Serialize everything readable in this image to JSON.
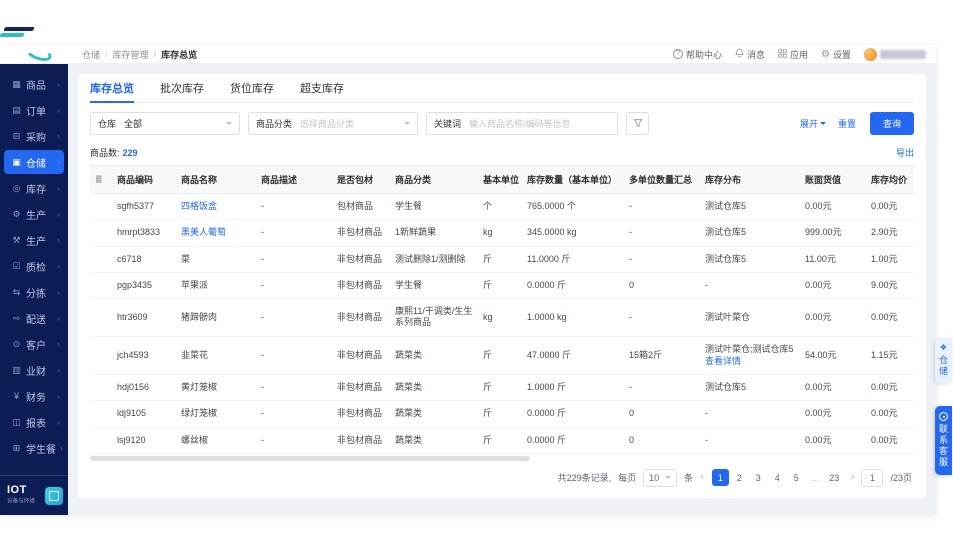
{
  "breadcrumb": {
    "items": [
      "仓储",
      "库存管理",
      "库存总览"
    ]
  },
  "topbar": {
    "help": "帮助中心",
    "messages": "消息",
    "apps": "应用",
    "settings": "设置"
  },
  "icons": {
    "help": "?",
    "gear": "⚙",
    "prev": "‹",
    "next": "›",
    "column_settings": "≣",
    "sidebar_chevron": "›",
    "warehouse_tag": "❖"
  },
  "sidebar": {
    "items": [
      {
        "id": "goods",
        "label": "商品",
        "glyph": "▦"
      },
      {
        "id": "orders",
        "label": "订单",
        "glyph": "▤"
      },
      {
        "id": "purchase",
        "label": "采购",
        "glyph": "⊟"
      },
      {
        "id": "warehouse",
        "label": "仓储",
        "glyph": "▣",
        "active": true
      },
      {
        "id": "inventory",
        "label": "库存",
        "glyph": "◎"
      },
      {
        "id": "production-1",
        "label": "生产",
        "glyph": "⚙"
      },
      {
        "id": "production-2",
        "label": "生产",
        "glyph": "⚒"
      },
      {
        "id": "quality",
        "label": "质检",
        "glyph": "☑"
      },
      {
        "id": "sorting",
        "label": "分拣",
        "glyph": "⇆"
      },
      {
        "id": "delivery",
        "label": "配送",
        "glyph": "⇨"
      },
      {
        "id": "customers",
        "label": "客户",
        "glyph": "⊙"
      },
      {
        "id": "biz-finance",
        "label": "业财",
        "glyph": "▥"
      },
      {
        "id": "finance",
        "label": "财务",
        "glyph": "¥"
      },
      {
        "id": "reports",
        "label": "报表",
        "glyph": "◫"
      },
      {
        "id": "student-meal",
        "label": "学生餐",
        "glyph": "⊞"
      }
    ],
    "iot": {
      "title": "IOT",
      "subtitle": "设备与环境"
    }
  },
  "tabs": [
    {
      "id": "overview",
      "label": "库存总览",
      "active": true
    },
    {
      "id": "batch",
      "label": "批次库存"
    },
    {
      "id": "location",
      "label": "货位库存"
    },
    {
      "id": "overdraft",
      "label": "超支库存"
    }
  ],
  "filters": {
    "warehouse": {
      "label": "仓库",
      "value": "全部"
    },
    "category": {
      "label": "商品分类",
      "placeholder": "选择商品分类"
    },
    "keyword": {
      "label": "关键词",
      "placeholder": "输入商品名称/编码等信息"
    },
    "expand": "展开",
    "reset": "重置",
    "search": "查询"
  },
  "summary": {
    "label": "商品数:",
    "count": "229",
    "export": "导出"
  },
  "table": {
    "headers": [
      "商品编码",
      "商品名称",
      "商品描述",
      "是否包材",
      "商品分类",
      "基本单位",
      "库存数量（基本单位）",
      "多单位数量汇总",
      "库存分布",
      "账面货值",
      "库存均价"
    ],
    "rows": [
      {
        "code": "sgfh5377",
        "name": "四格饭盒",
        "name_link": true,
        "desc": "-",
        "packing": "包材商品",
        "category": "学生餐",
        "unit": "个",
        "qty": "765.0000 个",
        "multi": "-",
        "dist": "测试仓库5",
        "dist_detail": "",
        "value": "0.00元",
        "price": "0.00元"
      },
      {
        "code": "hmrpt3833",
        "name": "黑美人葡萄",
        "name_link": true,
        "desc": "-",
        "packing": "非包材商品",
        "category": "1新鲜蔬果",
        "unit": "kg",
        "qty": "345.0000 kg",
        "multi": "-",
        "dist": "测试仓库5",
        "dist_detail": "",
        "value": "999.00元",
        "price": "2.90元"
      },
      {
        "code": "c6718",
        "name": "菜",
        "name_link": false,
        "desc": "-",
        "packing": "非包材商品",
        "category": "测试删除1/测删除",
        "unit": "斤",
        "qty": "11.0000 斤",
        "multi": "-",
        "dist": "测试仓库5",
        "dist_detail": "",
        "value": "11.00元",
        "price": "1.00元"
      },
      {
        "code": "pgp3435",
        "name": "苹果派",
        "name_link": false,
        "desc": "-",
        "packing": "非包材商品",
        "category": "学生餐",
        "unit": "斤",
        "qty": "0.0000 斤",
        "multi": "0",
        "dist": "-",
        "dist_detail": "",
        "value": "0.00元",
        "price": "9.00元"
      },
      {
        "code": "htr3609",
        "name": "猪蹄髈肉",
        "name_link": false,
        "desc": "-",
        "packing": "非包材商品",
        "category": "康熙11/干调类/生生系列商品",
        "unit": "kg",
        "qty": "1.0000 kg",
        "multi": "-",
        "dist": "测试叶菜仓",
        "dist_detail": "",
        "value": "0.00元",
        "price": "0.00元"
      },
      {
        "code": "jch4593",
        "name": "韭菜花",
        "name_link": false,
        "desc": "-",
        "packing": "非包材商品",
        "category": "蔬菜类",
        "unit": "斤",
        "qty": "47.0000 斤",
        "multi": "15箱2斤",
        "dist": "测试叶菜仓;测试仓库5",
        "dist_detail": "查看详情",
        "value": "54.00元",
        "price": "1.15元"
      },
      {
        "code": "hdj0156",
        "name": "黄灯笼椒",
        "name_link": false,
        "desc": "-",
        "packing": "非包材商品",
        "category": "蔬菜类",
        "unit": "斤",
        "qty": "1.0000 斤",
        "multi": "-",
        "dist": "测试仓库5",
        "dist_detail": "",
        "value": "0.00元",
        "price": "0.00元"
      },
      {
        "code": "ldj9105",
        "name": "绿灯笼椒",
        "name_link": false,
        "desc": "-",
        "packing": "非包材商品",
        "category": "蔬菜类",
        "unit": "斤",
        "qty": "0.0000 斤",
        "multi": "0",
        "dist": "-",
        "dist_detail": "",
        "value": "0.00元",
        "price": "0.00元"
      },
      {
        "code": "lsj9120",
        "name": "螺丝椒",
        "name_link": false,
        "desc": "-",
        "packing": "非包材商品",
        "category": "蔬菜类",
        "unit": "斤",
        "qty": "0.0000 斤",
        "multi": "0",
        "dist": "-",
        "dist_detail": "",
        "value": "0.00元",
        "price": "0.00元"
      }
    ]
  },
  "pagination": {
    "total": "共229条记录,",
    "per_page_label": "每页",
    "per_page_value": "10",
    "per_page_unit": "条",
    "pages": [
      "1",
      "2",
      "3",
      "4",
      "5",
      "...",
      "23"
    ],
    "active_index": 0,
    "jump_value": "1",
    "jump_suffix": "/23页"
  },
  "floating": {
    "warehouse_tag": "仓储",
    "contact": "联系客服"
  }
}
